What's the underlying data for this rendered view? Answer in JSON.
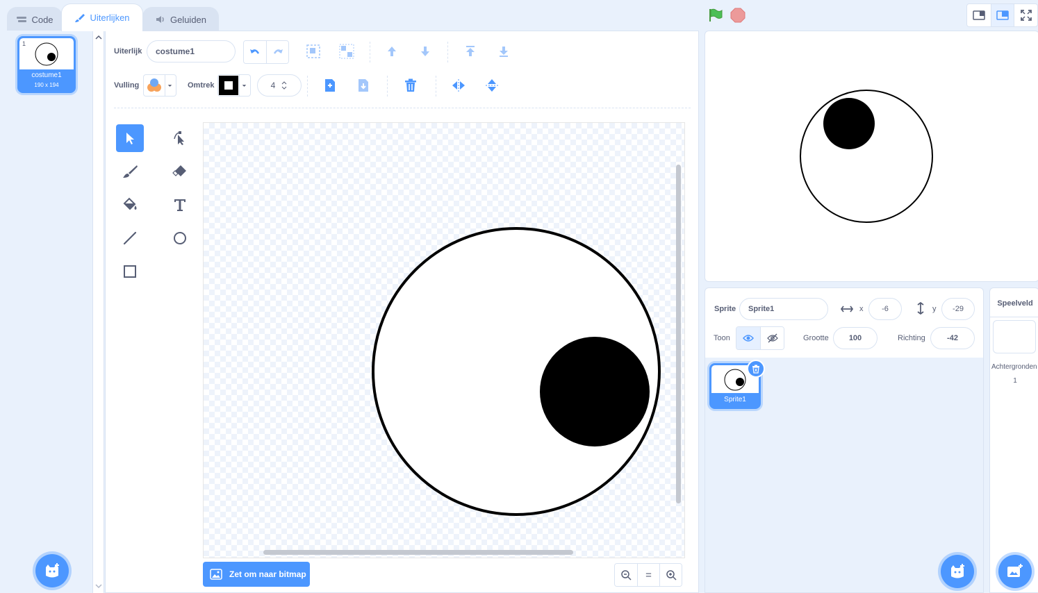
{
  "tabs": {
    "code": "Code",
    "costumes": "Uiterlijken",
    "sounds": "Geluiden"
  },
  "costume_list": {
    "items": [
      {
        "number": "1",
        "name": "costume1",
        "size": "190 x 194"
      }
    ]
  },
  "editor": {
    "costume_label": "Uiterlijk",
    "costume_name": "costume1",
    "fill_label": "Vulling",
    "outline_label": "Omtrek",
    "outline_width": "4",
    "convert_button": "Zet om naar bitmap",
    "zoom_reset": "="
  },
  "sprite_info": {
    "sprite_label": "Sprite",
    "sprite_name": "Sprite1",
    "x_label": "x",
    "x_value": "-6",
    "y_label": "y",
    "y_value": "-29",
    "show_label": "Toon",
    "size_label": "Grootte",
    "size_value": "100",
    "direction_label": "Richting",
    "direction_value": "-42"
  },
  "sprites": [
    {
      "name": "Sprite1"
    }
  ],
  "stage_pane": {
    "title": "Speelveld",
    "backdrops_label": "Achtergronden",
    "backdrops_count": "1"
  },
  "colors": {
    "accent": "#4c97ff",
    "green_flag": "#4cbf56",
    "stop": "#ec5959"
  }
}
